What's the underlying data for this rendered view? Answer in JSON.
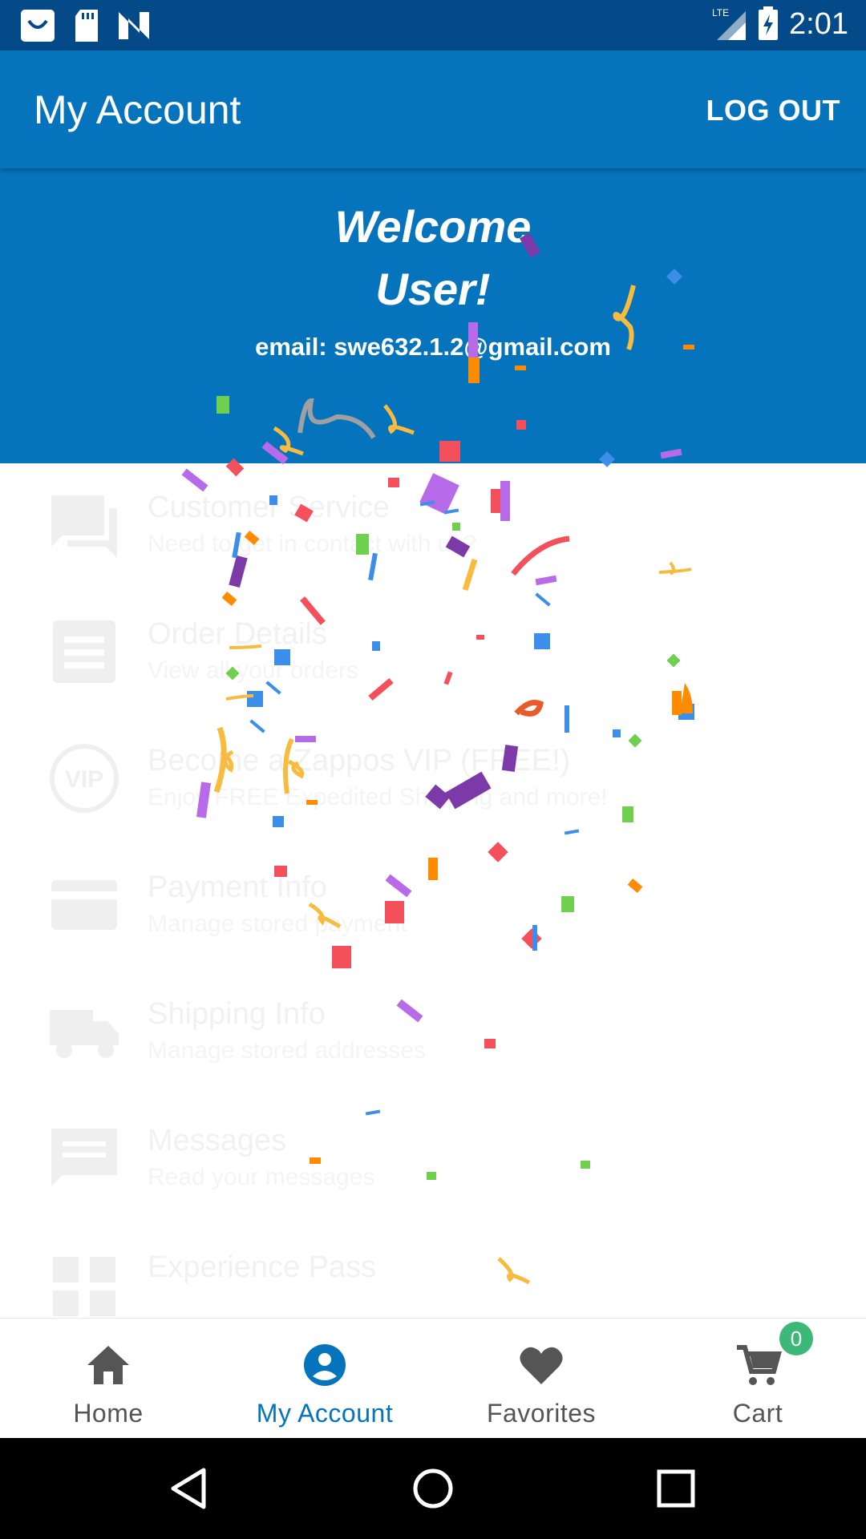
{
  "status_bar": {
    "time": "2:01",
    "network": "LTE",
    "left_icons": [
      "shopping-bag-icon",
      "sd-card-icon",
      "n-logo-icon"
    ]
  },
  "app_bar": {
    "title": "My Account",
    "logout_label": "LOG OUT"
  },
  "welcome": {
    "line1": "Welcome",
    "line2": "User!",
    "email": "email: swe632.1.2@gmail.com"
  },
  "menu": {
    "items": [
      {
        "title": "Customer Service",
        "subtitle": "Need to get in contact with us?",
        "icon": "chat-icon"
      },
      {
        "title": "Order Details",
        "subtitle": "View all your orders",
        "icon": "orders-icon"
      },
      {
        "title": "Become a Zappos VIP (FREE!)",
        "subtitle": "Enjoy FREE Expedited Shipping and more!",
        "icon": "vip-icon"
      },
      {
        "title": "Payment Info",
        "subtitle": "Manage stored payment",
        "icon": "credit-card-icon"
      },
      {
        "title": "Shipping Info",
        "subtitle": "Manage stored addresses",
        "icon": "truck-icon"
      },
      {
        "title": "Messages",
        "subtitle": "Read your messages",
        "icon": "message-icon"
      },
      {
        "title": "Experience Pass",
        "subtitle": "",
        "icon": "pass-icon"
      }
    ]
  },
  "bottom_nav": {
    "items": [
      {
        "label": "Home",
        "icon": "home-icon"
      },
      {
        "label": "My Account",
        "icon": "account-icon"
      },
      {
        "label": "Favorites",
        "icon": "heart-icon"
      },
      {
        "label": "Cart",
        "icon": "cart-icon"
      }
    ],
    "cart_count": "0"
  },
  "colors": {
    "primary": "#0674bd",
    "status_bar": "#044a88",
    "badge": "#3cb878"
  }
}
